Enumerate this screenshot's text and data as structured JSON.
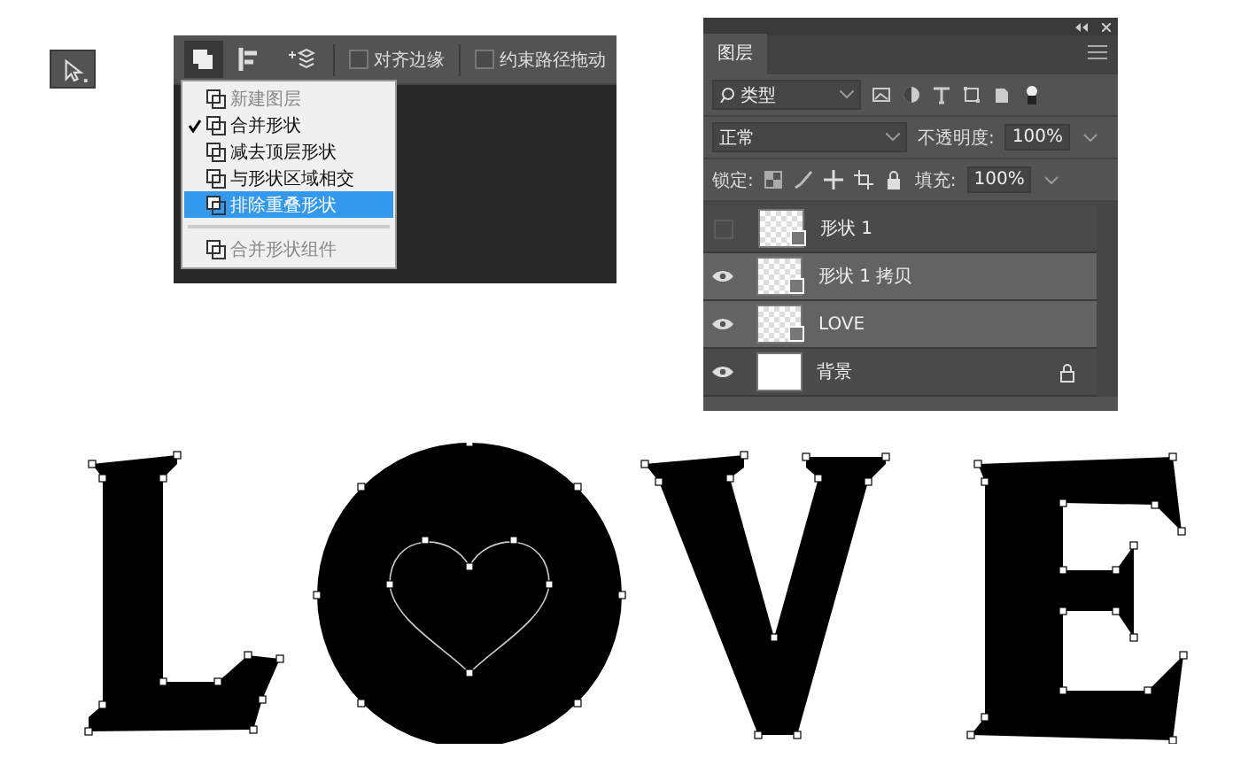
{
  "toolbar": {
    "checkboxes": [
      {
        "label": "对齐边缘",
        "checked": false
      },
      {
        "label": "约束路径拖动",
        "checked": false
      }
    ]
  },
  "path_menu": {
    "items": [
      {
        "label": "新建图层",
        "checked": false,
        "selected": false,
        "disabled": true
      },
      {
        "label": "合并形状",
        "checked": true,
        "selected": false,
        "disabled": false
      },
      {
        "label": "减去顶层形状",
        "checked": false,
        "selected": false,
        "disabled": false
      },
      {
        "label": "与形状区域相交",
        "checked": false,
        "selected": false,
        "disabled": false
      },
      {
        "label": "排除重叠形状",
        "checked": false,
        "selected": true,
        "disabled": false
      },
      {
        "label": "合并形状组件",
        "checked": false,
        "selected": false,
        "disabled": true
      }
    ]
  },
  "layers_panel": {
    "tab": "图层",
    "filter": "类型",
    "blend_mode": "正常",
    "opacity_label": "不透明度:",
    "opacity": "100%",
    "lock_label": "锁定:",
    "fill_label": "填充:",
    "fill": "100%",
    "layers": [
      {
        "name": "形状 1",
        "visible": false,
        "selected": false,
        "kind": "shape",
        "locked": false
      },
      {
        "name": "形状 1 拷贝",
        "visible": true,
        "selected": true,
        "kind": "shape",
        "locked": false
      },
      {
        "name": "LOVE",
        "visible": true,
        "selected": true,
        "kind": "shape",
        "locked": false
      },
      {
        "name": "背景",
        "visible": true,
        "selected": false,
        "kind": "background",
        "locked": true
      }
    ]
  }
}
